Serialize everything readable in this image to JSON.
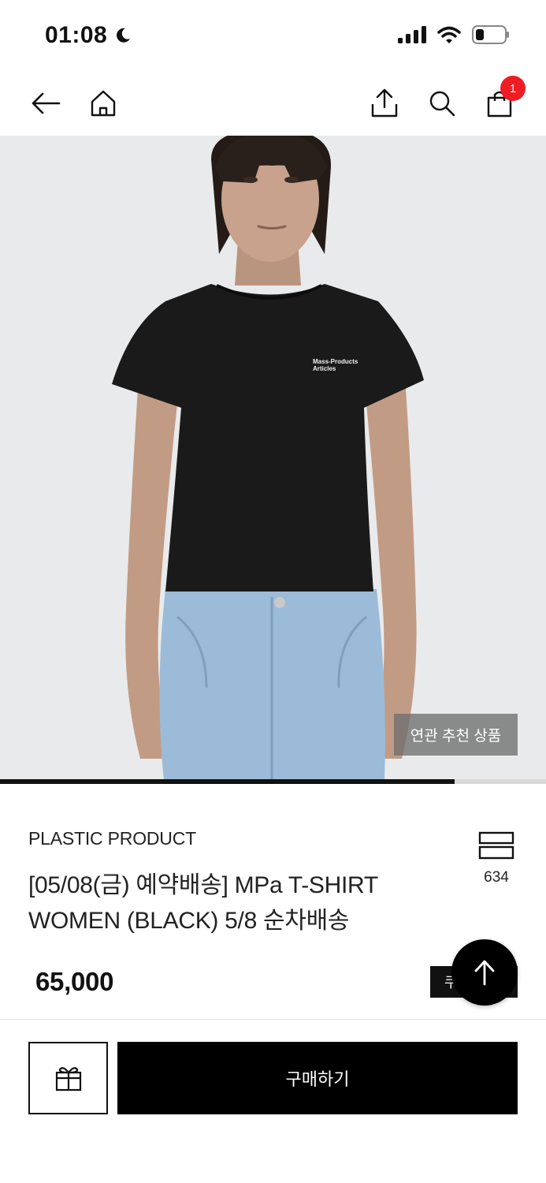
{
  "status_bar": {
    "time": "01:08",
    "icons": [
      "moon-icon",
      "signal-icon",
      "wifi-icon",
      "battery-icon"
    ]
  },
  "nav": {
    "icons": [
      "back-arrow-icon",
      "home-icon",
      "share-icon",
      "search-icon",
      "shopping-bag-icon"
    ],
    "cart_count": "1"
  },
  "hero": {
    "shirt_print": [
      "Mass-Products",
      "Articles"
    ],
    "related_label": "연관 추천 상품",
    "gallery_progress": 0.833
  },
  "product": {
    "brand": "PLASTIC PRODUCT",
    "title_line1": "[05/08(금) 예약배송]  MPa T-SHIRT",
    "title_line2": "WOMEN (BLACK) 5/8 순차배송",
    "like_count": "634",
    "price": "65,000",
    "coupon_label": "쿠폰받기"
  },
  "actions": {
    "buy_label": "구매하기"
  },
  "colors": {
    "badge": "#ee1d23",
    "primary": "#000000",
    "shirt": "#1a1a1b",
    "denim": "#9cbbd8"
  }
}
